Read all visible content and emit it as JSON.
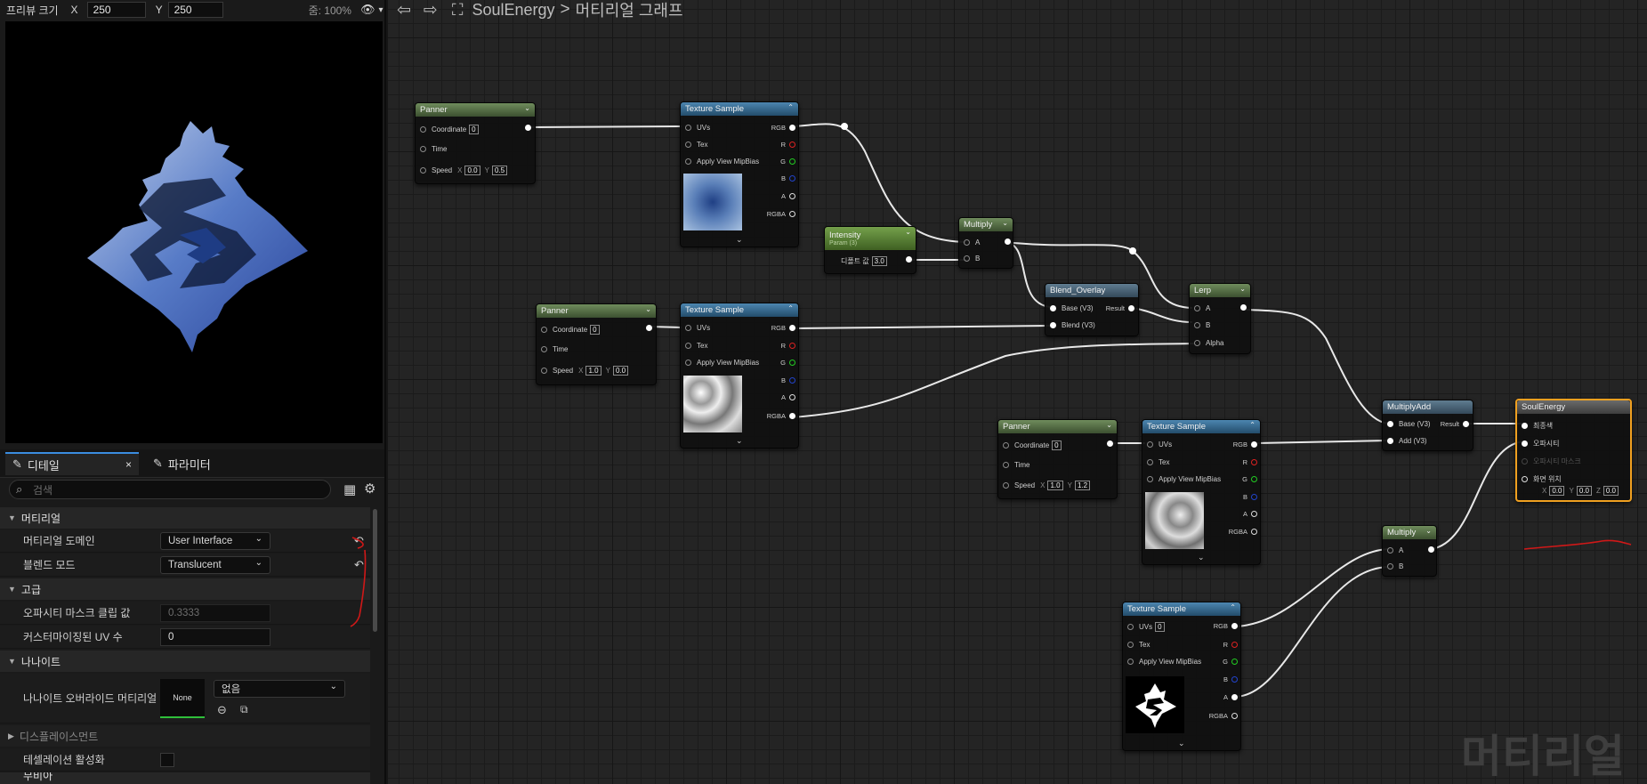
{
  "preview": {
    "size_label": "프리뷰 크기",
    "x_label": "X",
    "x_value": "250",
    "y_label": "Y",
    "y_value": "250",
    "zoom": "줌: 100%"
  },
  "details": {
    "tab_details": "디테일",
    "tab_params": "파라미터",
    "search_placeholder": "검색",
    "sections": {
      "material": "머티리얼",
      "advanced": "고급",
      "nanite": "나나이트",
      "displacement": "디스플레이스먼트",
      "next": "무비아"
    },
    "rows": {
      "domain_label": "머티리얼 도메인",
      "domain_value": "User Interface",
      "blend_label": "블렌드 모드",
      "blend_value": "Translucent",
      "clip_label": "오파시티 마스크 클립 값",
      "clip_value": "0.3333",
      "uv_label": "커스터마이징된 UV 수",
      "uv_value": "0",
      "nanite_label": "나나이트 오버라이드 머티리얼",
      "nanite_none": "None",
      "nanite_value": "없음",
      "tess_label": "테셀레이션 활성화"
    }
  },
  "graph": {
    "breadcrumb_asset": "SoulEnergy",
    "breadcrumb_sep": ">",
    "breadcrumb_page": "머티리얼 그래프",
    "watermark": "머티리얼",
    "nodes": {
      "panner1": {
        "title": "Panner",
        "coord": "Coordinate",
        "coord_v": "0",
        "time": "Time",
        "speed": "Speed",
        "sx": "0.0",
        "sy": "0.5",
        "x": "X",
        "y": "Y"
      },
      "tex1": {
        "title": "Texture Sample",
        "uvs": "UVs",
        "tex": "Tex",
        "mip": "Apply View MipBias"
      },
      "intensity": {
        "title": "Intensity",
        "sub": "Param (3)",
        "label": "디폴트 값",
        "value": "3.0"
      },
      "mult1": {
        "title": "Multiply",
        "a": "A",
        "b": "B"
      },
      "panner2": {
        "title": "Panner",
        "coord": "Coordinate",
        "coord_v": "0",
        "time": "Time",
        "speed": "Speed",
        "sx": "1.0",
        "sy": "0.0",
        "x": "X",
        "y": "Y"
      },
      "tex2": {
        "title": "Texture Sample",
        "uvs": "UVs",
        "tex": "Tex",
        "mip": "Apply View MipBias"
      },
      "blend": {
        "title": "Blend_Overlay",
        "base": "Base (V3)",
        "blend": "Blend (V3)",
        "result": "Result"
      },
      "lerp": {
        "title": "Lerp",
        "a": "A",
        "b": "B",
        "alpha": "Alpha"
      },
      "panner3": {
        "title": "Panner",
        "coord": "Coordinate",
        "coord_v": "0",
        "time": "Time",
        "speed": "Speed",
        "sx": "1.0",
        "sy": "1.2",
        "x": "X",
        "y": "Y"
      },
      "tex3": {
        "title": "Texture Sample",
        "uvs": "UVs",
        "tex": "Tex",
        "mip": "Apply View MipBias"
      },
      "madd": {
        "title": "MultiplyAdd",
        "base": "Base (V3)",
        "add": "Add (V3)",
        "result": "Result"
      },
      "mult2": {
        "title": "Multiply",
        "a": "A",
        "b": "B"
      },
      "tex4": {
        "title": "Texture Sample",
        "uvs": "UVs",
        "uvs_v": "0",
        "tex": "Tex",
        "mip": "Apply View MipBias"
      },
      "out": {
        "title": "SoulEnergy",
        "final": "최종색",
        "opacity": "오파시티",
        "mask": "오파시티 마스크",
        "pos": "화면 위치",
        "px": "0.0",
        "py": "0.0",
        "pz": "0.0",
        "x": "X",
        "y": "Y",
        "z": "Z"
      },
      "outs": {
        "rgb": "RGB",
        "r": "R",
        "g": "G",
        "b": "B",
        "a": "A",
        "rgba": "RGBA"
      }
    }
  }
}
